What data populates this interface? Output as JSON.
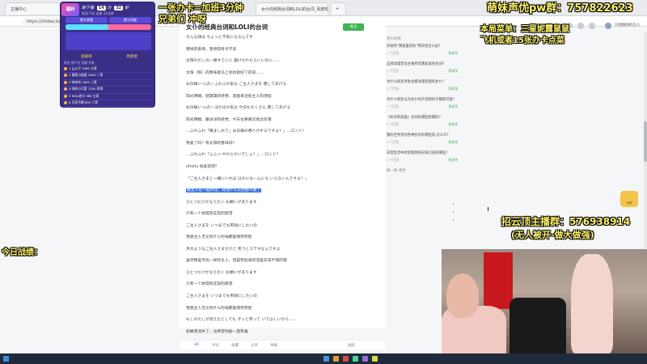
{
  "browser": {
    "tabs": [
      "主播中心",
      "女仆的经典台词和LOLI的台词_百度知道",
      ""
    ],
    "address": "https://zhidao.baidu.com/question/..."
  },
  "page": {
    "title": "女仆的经典台词和LOLI的台词",
    "follow_label": "关注",
    "lines": [
      "そんな顔は ちょっと不安になるんです",
      "那样的表情，我觉得有点不安",
      "太阳わたしの一番すてにに 届けたれたらいいのに……",
      "太阳（阳）的香味能马上到达就好了的说……",
      "お日様いっぱい ふわふわ気分 ご主人さまを 癒してあげる",
      "阳光明媚，轻飘飘的感觉，就能来治愈主人的烦恼",
      "お日様いっぱい ほかほか気分 今日もたくさん 癒してあげる",
      "阳光明媚，暖洋洋的感觉，今天也要再次地治愈哦",
      "…ふわふわ「晴ましめて」お日様の香りがするですよ？」…ロンド！",
      "我爱了吗？有太阳的香味吗？",
      "…ふわふわ「ふふっ やわらかいでしょ？」…ロンド？",
      "uhuhu 很柔软吧？",
      "「ご主人さまと一緒にいれば ほかになーんにも いらないんですよ？」",
      "跟主人在一起的话，其他什么东西都不要了",
      "ひとつだけかなえたい お願いがあります",
      "只有一个想得到实现的愿望",
      "ご主人さまを いつまでも笑顔にしたいの",
      "我想主人无论到什么时候都能保持笑脸",
      "月のようなご主人さまだけど 笑うとステキなんですよ",
      "虽然像是月亮一样的主人，但是笑起来的话是非常不错的哦",
      "ひとつだけかなえたい お願いがあります",
      "只有一个想得到实现的愿望",
      "ご主人さまを いつまでも笑顔にしたいの",
      "我想主人无论到什么时候都能保持笑脸",
      "もしわたしが消えたとしても ずっと笑って いてほしいから……",
      "如果我消失了，也希望你能一直笑着"
    ],
    "selected_line": "跟主人在一起的话，其他什么东西都不要了",
    "actions": [
      "28",
      "评论",
      "收藏",
      "分享",
      "举报"
    ],
    "actions_right": "收起"
  },
  "sidebar": {
    "header": "我也想看",
    "items": [
      {
        "title": "日语的\"我很喜欢你\"用日语怎么说?",
        "meta": "1 个回答",
        "badge": "我来答"
      },
      {
        "title": "这部动漫里女主角经常重复说的台词?",
        "meta": "1 个回答",
        "badge": "我来答"
      },
      {
        "title": "为什么很多男生会看动漫里面的女仆?",
        "meta": "2 个回答",
        "badge": "我来答"
      },
      {
        "title": "为什么男生认为女仆的声音和样子都很可爱?",
        "meta": "1 个回答",
        "badge": "我来答"
      },
      {
        "title": "《冬日的温柔》台词有哪些经典的?",
        "meta": "5 个回答",
        "badge": "我来答"
      },
      {
        "title": "我的世界里的各种台词有哪些的,怎么写?",
        "meta": "1 个回答",
        "badge": "我来答"
      },
      {
        "title": "日常生活中经常使用的日语口语有哪些?",
        "meta": "1 个回答",
        "badge": "我来答"
      }
    ],
    "more": "换一换 更多"
  },
  "topright": {
    "user": "只想做你的大人"
  },
  "stream_panel": {
    "badge": "福利",
    "stats": [
      "14",
      "32"
    ],
    "stats_labels": [
      "距下播",
      "分",
      "秒"
    ],
    "sub": "距离下场 还剩 32分钟",
    "cats": [
      "累计观看",
      "累计贡献"
    ],
    "sections": [
      "超级榜",
      "周星榜"
    ],
    "header": "排名  用户名   贡献  关系",
    "rows": [
      "1  云公子       3380  大哥",
      "2  蔷薇小姐姐   2600  二哥",
      "3  哈哈哈       1800  三哥",
      "4  你的小可爱   1200  四哥",
      "5  Kitty老大    980   五哥",
      "6  月亮不睡     800   六哥"
    ]
  },
  "overlays": {
    "top_left": "一张办卡=加班3分钟",
    "top_left2": "兄弟们 冲呀",
    "top_right": "萌妹声优pw群：757822623",
    "menu1": "本局菜单：三星妮露鼠鼠",
    "menu2": "飞机或者15张办卡点菜",
    "recruit": "招云顶主播群：576938914",
    "recruit2": "(无人被开-做大做强)",
    "today": "今日战绩："
  },
  "gift": {
    "label": "礼物"
  }
}
